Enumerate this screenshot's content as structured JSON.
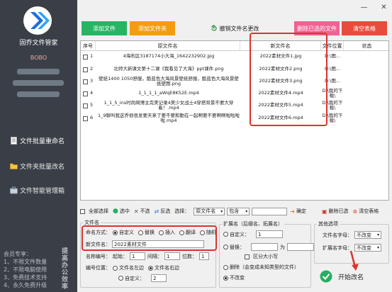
{
  "app": {
    "name": "固乔文件管家",
    "user": "BOBO"
  },
  "sidebar": {
    "nav": [
      {
        "label": "文件批量重命名",
        "icon": "document-icon"
      },
      {
        "label": "文件夹批量改名",
        "icon": "folder-icon"
      },
      {
        "label": "文件智能管理箱",
        "icon": "toolbox-icon"
      }
    ],
    "member_lines": [
      "会员专享：",
      "1、不限文件数量",
      "2、不限电脑使用",
      "3、免费技术支持",
      "4、永久免费升级"
    ],
    "member_side": "提高办公效率"
  },
  "toolbar": {
    "add_file": "添加文件",
    "add_folder": "添加文件夹",
    "restore": "撤销文件名更改",
    "delete_selected": "删除已选的文件",
    "clear_table": "清空表格",
    "colors": {
      "add_file": "#28b463",
      "add_folder": "#f39c12",
      "delete": "#f06292",
      "clear": "#e74c3c"
    }
  },
  "table": {
    "headers": [
      "序号",
      "原文件名",
      "新文件名",
      "文件位置",
      "状态"
    ],
    "rows": [
      {
        "idx": "1",
        "orig": "4海布区3187174小大海_1642232902.jpg",
        "new": "2022素材文件1.jpg",
        "loc": "D:\\图..."
      },
      {
        "idx": "2",
        "orig": "北师大新课文第十二课《我看见了大海》ppt课件.png",
        "new": "2022素材文件2.png",
        "loc": "D:\\图..."
      },
      {
        "idx": "3",
        "orig": "壁纸1400 1050舒服，酷蓝色大海风景壁纸舒服，酷蓝色大海风景壁纸壁图.png",
        "new": "2022素材文件3.png",
        "loc": "D:\\图..."
      },
      {
        "idx": "4",
        "orig": "1_1_1_1_aWqE8K52E.mp4",
        "new": "2022素材文件4.mp4",
        "loc": "D:\\我的下载\\"
      },
      {
        "idx": "5",
        "orig": "1_1_5_ins时尚网博主完美记录4美少女战士4穿搭背景不要大穿着！.mp4",
        "new": "2022素材文件5.mp4",
        "loc": "D:\\我的下载\\"
      },
      {
        "idx": "6",
        "orig": "1_9聊叫我这乔很很发要天来了要不要和勤在一起啊要不要啊啊啦啦啦啦.mp4",
        "new": "2022素材文件6.mp4",
        "loc": "D:\\我的下载\\"
      }
    ]
  },
  "selectbar": {
    "select_all": "全部选择",
    "select_on": "选中",
    "select_off": "不选",
    "invert": "反选",
    "select_label": "选择：",
    "field_value": "原文件名",
    "mode_value": "包含",
    "confirm": "确定",
    "delete_selected": "删除已选",
    "clear_table": "清空表格"
  },
  "filename_group": {
    "title": "文件名",
    "mode_label": "命名方式：",
    "modes": [
      "自定义",
      "替换",
      "插入",
      "翻译",
      "随机"
    ],
    "newname_label": "新文件名：",
    "newname_value": "2022素材文件",
    "number_label": "名称编号：",
    "start_label": "起始：",
    "start_value": "1",
    "step_label": "间隔：",
    "step_value": "1",
    "digits_label": "位数：",
    "digits_value": "1",
    "position_label": "编号位置：",
    "pos_left": "文件名左边",
    "pos_right": "文件名右边",
    "custom_label": "自定义：",
    "custom_value": "2"
  },
  "ext_group": {
    "title": "扩展名（后缀名、拓展名）",
    "custom": "自定义：",
    "custom_value": "1",
    "replace": "替换：",
    "for_label": "为",
    "case": "区分大小写",
    "delete": "删除（会变成未知类型的文件）",
    "unchanged": "不改变"
  },
  "other_group": {
    "title": "其他选项",
    "name_case_label": "文件名字母：",
    "name_case_value": "不改变",
    "ext_case_label": "扩展名字母：",
    "ext_case_value": "不改变",
    "start_button": "开始改名"
  }
}
